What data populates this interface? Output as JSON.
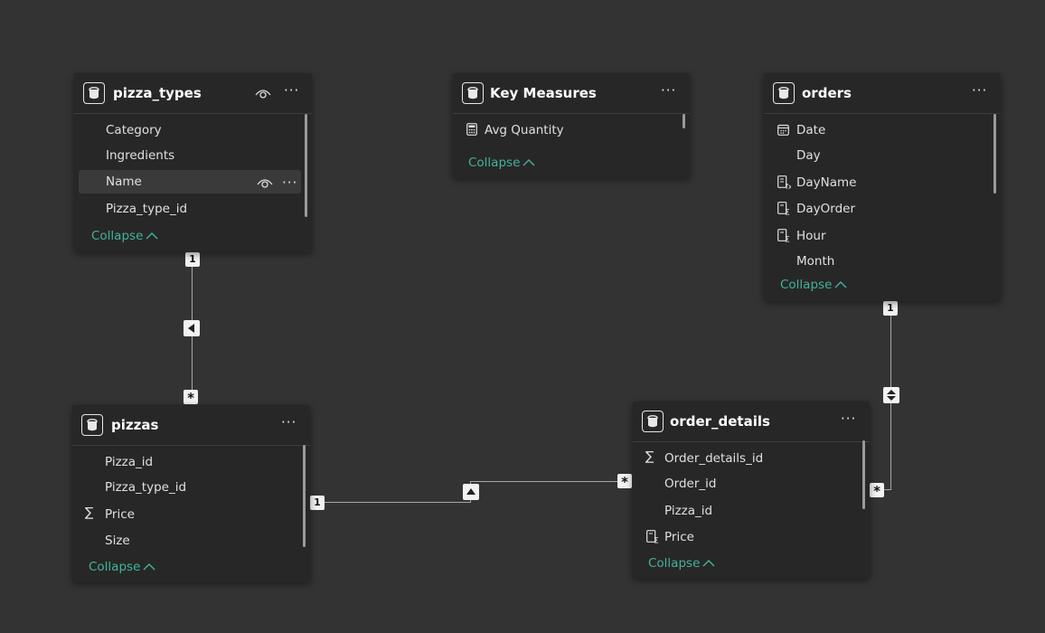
{
  "tables": {
    "pizza_types": {
      "title": "pizza_types",
      "fields": [
        "Category",
        "Ingredients",
        "Name",
        "Pizza_type_id"
      ],
      "collapse": "Collapse"
    },
    "key_measures": {
      "title": "Key Measures",
      "fields": [
        "Avg Quantity"
      ],
      "collapse": "Collapse"
    },
    "orders": {
      "title": "orders",
      "fields": [
        "Date",
        "Day",
        "DayName",
        "DayOrder",
        "Hour",
        "Month"
      ],
      "collapse": "Collapse"
    },
    "pizzas": {
      "title": "pizzas",
      "fields": [
        "Pizza_id",
        "Pizza_type_id",
        "Price",
        "Size"
      ],
      "collapse": "Collapse"
    },
    "order_details": {
      "title": "order_details",
      "fields": [
        "Order_details_id",
        "Order_id",
        "Pizza_id",
        "Price"
      ],
      "collapse": "Collapse"
    }
  },
  "relationships": {
    "one": "1",
    "many": "*"
  },
  "menu_glyph": "···",
  "colors": {
    "canvas": "#333333",
    "card": "#272727",
    "accent": "#3eb59b"
  }
}
